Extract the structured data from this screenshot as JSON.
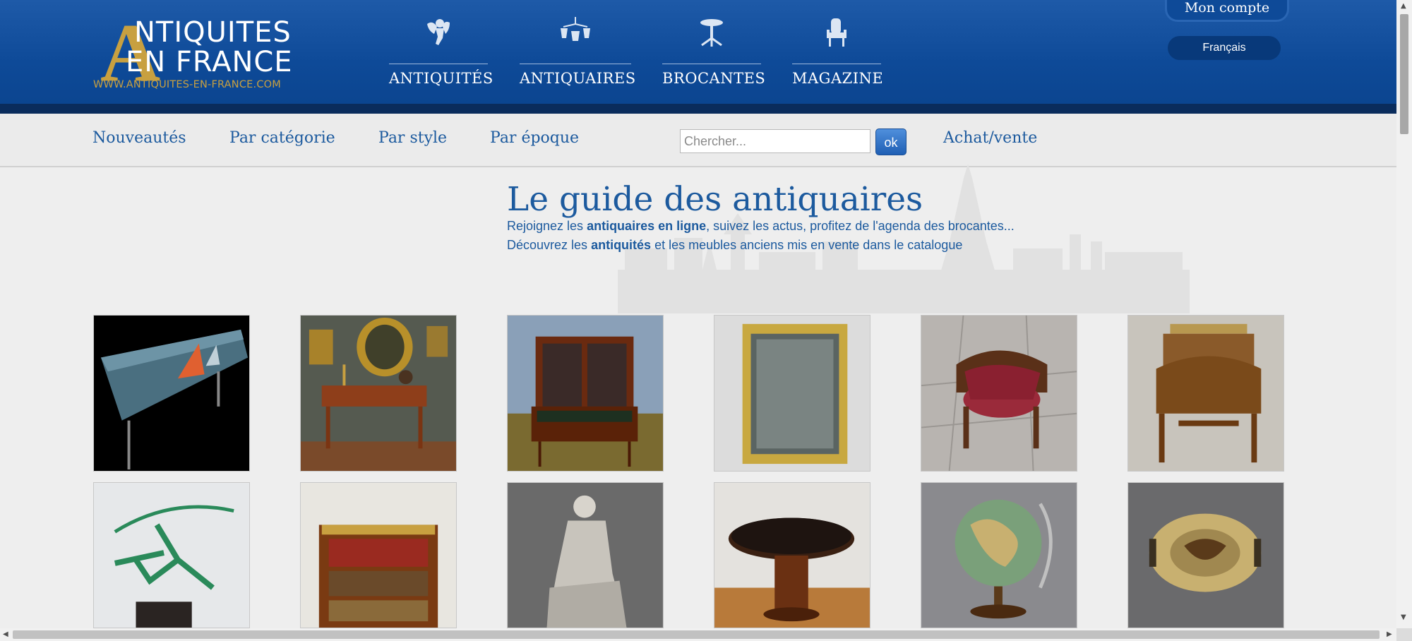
{
  "logo": {
    "initial": "A",
    "line1": "NTIQUITES",
    "line2": "EN FRANCE",
    "url": "WWW.ANTIQUITES-EN-FRANCE.COM",
    "gold": "#c8a040"
  },
  "main_nav": [
    {
      "label": "ANTIQUITÉS",
      "icon": "cherub-icon"
    },
    {
      "label": "ANTIQUAIRES",
      "icon": "chandelier-icon"
    },
    {
      "label": "BROCANTES",
      "icon": "pedestal-table-icon"
    },
    {
      "label": "MAGAZINE",
      "icon": "armchair-icon"
    }
  ],
  "account": {
    "label": "Mon compte"
  },
  "language": {
    "label": "Français"
  },
  "sub_nav": [
    "Nouveautés",
    "Par catégorie",
    "Par style",
    "Par époque",
    "Achat/vente"
  ],
  "search": {
    "placeholder": "Chercher...",
    "value": "",
    "button": "ok"
  },
  "hero": {
    "title": "Le guide des antiquaires",
    "line1": {
      "before": "Rejoignez les ",
      "bold": "antiquaires en ligne",
      "after": ", suivez les actus, profitez de l'agenda des brocantes..."
    },
    "line2": {
      "before": "Découvrez les ",
      "bold": "antiquités",
      "after": " et les meubles anciens mis en vente dans le catalogue"
    }
  },
  "products": [
    {
      "name": "tile-table-mosaic"
    },
    {
      "name": "writing-desk-mahogany"
    },
    {
      "name": "secretary-bookcase"
    },
    {
      "name": "gilt-mirror"
    },
    {
      "name": "leather-office-armchair"
    },
    {
      "name": "bonheur-du-jour-desk"
    },
    {
      "name": "art-deco-hoop-dancer"
    },
    {
      "name": "bookcase-cabinet"
    },
    {
      "name": "marble-statue"
    },
    {
      "name": "round-pedestal-table"
    },
    {
      "name": "terrestrial-globe"
    },
    {
      "name": "ceramic-flask"
    }
  ],
  "colors": {
    "header_blue": "#0e4a98",
    "header_band": "#0a2c5c",
    "link_blue": "#1c5a9e",
    "page_bg": "#eeeeee"
  }
}
